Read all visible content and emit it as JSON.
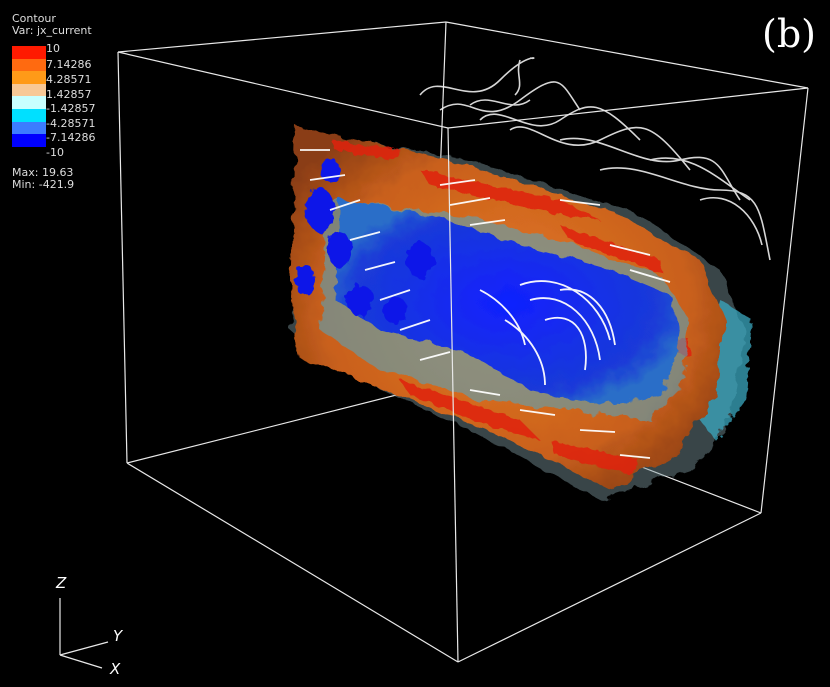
{
  "panel_label": "(b)",
  "legend": {
    "title": "Contour",
    "var_line": "Var: jx_current",
    "ticks": [
      "10",
      "7.14286",
      "4.28571",
      "1.42857",
      "-1.42857",
      "-4.28571",
      "-7.14286",
      "-10"
    ],
    "colors": [
      "#ff1a00",
      "#ff6a10",
      "#ff9a18",
      "#f8c896",
      "#c8ffff",
      "#00e0ff",
      "#3c7cff",
      "#0000ff"
    ],
    "max_line": "Max:  19.63",
    "min_line": "Min: -421.9"
  },
  "axes": {
    "z": "Z",
    "y": "Y",
    "x": "X"
  }
}
